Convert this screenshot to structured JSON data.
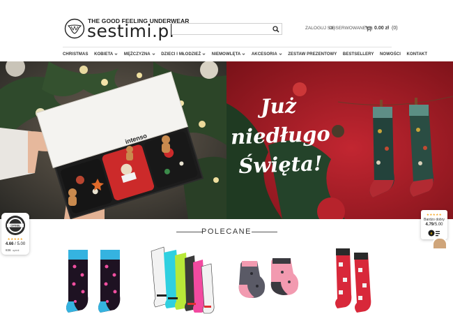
{
  "brand": {
    "tagline": "THE GOOD FEELING UNDERWEAR",
    "name": "sestimi.pl"
  },
  "search": {
    "value": "",
    "placeholder": ""
  },
  "account": {
    "login": "ZALOGUJ SIĘ",
    "wishlist": "OBSERWOWANE (0)",
    "cart_total": "0.00 zł",
    "cart_count": "(0)"
  },
  "nav": {
    "items": [
      {
        "label": "CHRISTMAS"
      },
      {
        "label": "KOBIETA"
      },
      {
        "label": "MĘŻCZYZNA"
      },
      {
        "label": "DZIECI I MŁODZIEŻ"
      },
      {
        "label": "NIEMOWLĘTA"
      },
      {
        "label": "AKCESORIA"
      },
      {
        "label": "ZESTAW PREZENTOWY"
      },
      {
        "label": "BESTSELLERY"
      },
      {
        "label": "NOWOŚCI"
      },
      {
        "label": "KONTAKT"
      }
    ]
  },
  "hero": {
    "box_brand": "intenso",
    "headline": [
      "Już",
      "niedługo",
      "Święta!"
    ]
  },
  "opinie_badge": {
    "brand": "OPINIE",
    "stars": "★★★★★",
    "score": "4.66",
    "max": "/ 5.00",
    "count": "836",
    "count_label": "opinii"
  },
  "trusted_badge": {
    "stars": "★★★★★",
    "grade": "Bardzo dobry",
    "score": "4.79",
    "max": "/5.00"
  },
  "section": {
    "title": "POLECANE"
  },
  "colors": {
    "accent_orange": "#f5a623",
    "hero_red": "#b31e2b",
    "nav_text": "#333333"
  }
}
